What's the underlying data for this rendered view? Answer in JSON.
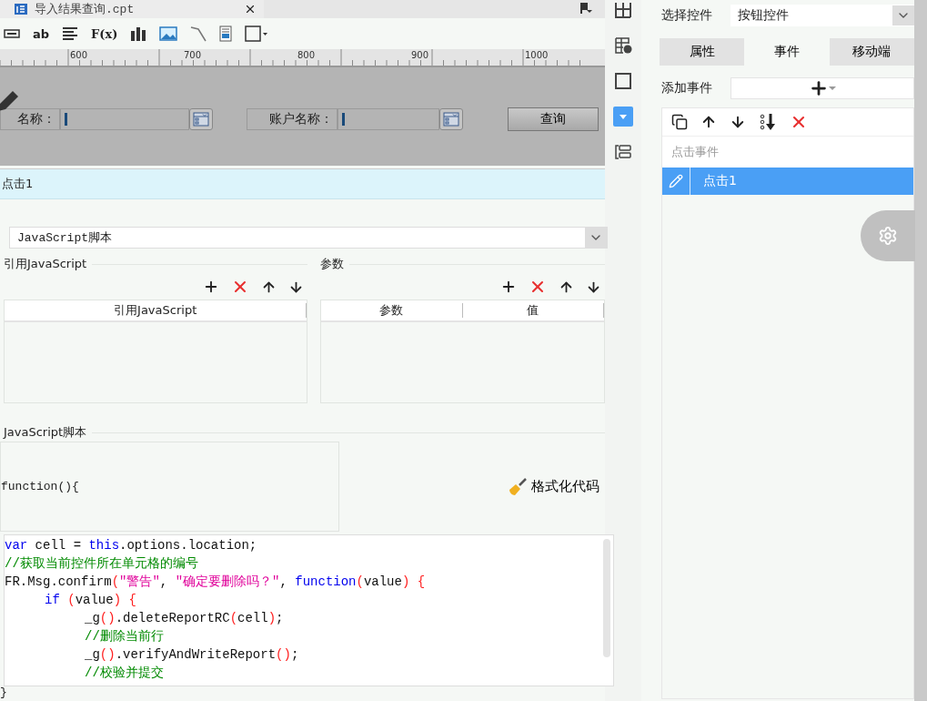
{
  "file_tab": {
    "title": "导入结果查询.cpt"
  },
  "toolbar": [
    {
      "kind": "icon"
    },
    {
      "kind": "text",
      "label": "ab"
    },
    {
      "kind": "icon"
    },
    {
      "kind": "text",
      "label": "F(x)"
    },
    {
      "kind": "icon"
    },
    {
      "kind": "icon"
    },
    {
      "kind": "icon"
    },
    {
      "kind": "icon"
    },
    {
      "kind": "icon"
    }
  ],
  "ruler": {
    "labels": [
      "600",
      "700",
      "800",
      "900",
      "1000"
    ]
  },
  "form": {
    "fields": [
      {
        "label": "名称："
      },
      {
        "label": "账户名称："
      }
    ],
    "button": "查询"
  },
  "dialog": {
    "title": "点击1",
    "type_select": "JavaScript脚本",
    "ref_section": {
      "title": "引用JavaScript",
      "columns": [
        "引用JavaScript"
      ]
    },
    "param_section": {
      "title": "参数",
      "columns": [
        "参数",
        "值"
      ]
    },
    "script_section": {
      "title": "JavaScript脚本",
      "header": "function(){",
      "format_button": "格式化代码",
      "footer": "}",
      "code": [
        {
          "segments": [
            {
              "text": "var",
              "kind": "keyword"
            },
            {
              "text": " cell = ",
              "kind": "plain"
            },
            {
              "text": "this",
              "kind": "keyword"
            },
            {
              "text": ".options.location;",
              "kind": "plain"
            }
          ]
        },
        {
          "segments": [
            {
              "text": "//获取当前控件所在单元格的编号",
              "kind": "comment"
            }
          ]
        },
        {
          "segments": [
            {
              "text": "FR.Msg.confirm",
              "kind": "plain"
            },
            {
              "text": "(",
              "kind": "paren"
            },
            {
              "text": "\"警告\"",
              "kind": "string"
            },
            {
              "text": ", ",
              "kind": "plain"
            },
            {
              "text": "\"确定要删除吗？\"",
              "kind": "string"
            },
            {
              "text": ", ",
              "kind": "plain"
            },
            {
              "text": "function",
              "kind": "keyword"
            },
            {
              "text": "(",
              "kind": "paren"
            },
            {
              "text": "value",
              "kind": "plain"
            },
            {
              "text": ")",
              "kind": "paren"
            },
            {
              "text": " {",
              "kind": "paren"
            }
          ],
          "children": [
            {
              "segments": [
                {
                  "text": "if",
                  "kind": "keyword"
                },
                {
                  "text": " (",
                  "kind": "paren"
                },
                {
                  "text": "value",
                  "kind": "plain"
                },
                {
                  "text": ")",
                  "kind": "paren"
                },
                {
                  "text": " {",
                  "kind": "paren"
                }
              ],
              "children": [
                {
                  "segments": [
                    {
                      "text": "_g",
                      "kind": "plain"
                    },
                    {
                      "text": "()",
                      "kind": "paren"
                    },
                    {
                      "text": ".deleteReportRC",
                      "kind": "plain"
                    },
                    {
                      "text": "(",
                      "kind": "paren"
                    },
                    {
                      "text": "cell",
                      "kind": "plain"
                    },
                    {
                      "text": ")",
                      "kind": "paren"
                    },
                    {
                      "text": ";",
                      "kind": "plain"
                    }
                  ]
                },
                {
                  "segments": [
                    {
                      "text": "//删除当前行",
                      "kind": "comment"
                    }
                  ]
                },
                {
                  "segments": [
                    {
                      "text": "_g",
                      "kind": "plain"
                    },
                    {
                      "text": "()",
                      "kind": "paren"
                    },
                    {
                      "text": ".verifyAndWriteReport",
                      "kind": "plain"
                    },
                    {
                      "text": "()",
                      "kind": "paren"
                    },
                    {
                      "text": ";",
                      "kind": "plain"
                    }
                  ]
                },
                {
                  "segments": [
                    {
                      "text": "//校验并提交",
                      "kind": "comment"
                    }
                  ]
                }
              ]
            }
          ]
        }
      ]
    }
  },
  "side_icons": [
    {
      "selected": false
    },
    {
      "selected": false
    },
    {
      "selected": false
    },
    {
      "selected": true
    },
    {
      "selected": false
    }
  ],
  "panel": {
    "select_label": "选择控件",
    "select_value": "按钮控件",
    "tabs": [
      {
        "label": "属性",
        "selected": false
      },
      {
        "label": "事件",
        "selected": true
      },
      {
        "label": "移动端",
        "selected": false
      }
    ],
    "add_label": "添加事件",
    "events": {
      "header": "点击事件",
      "items": [
        {
          "label": "点击1",
          "selected": true
        }
      ]
    }
  }
}
